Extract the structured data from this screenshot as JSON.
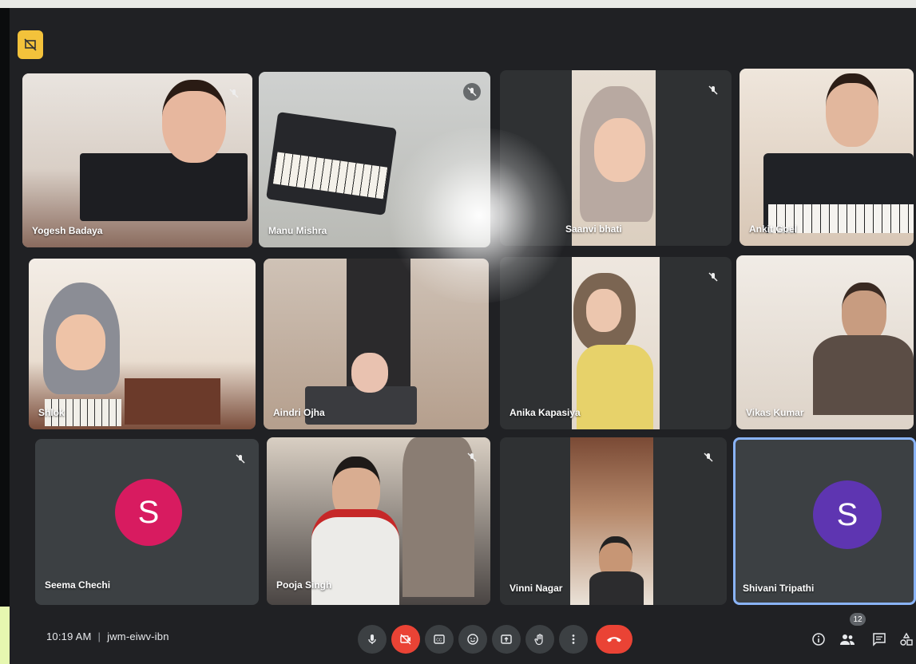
{
  "meeting": {
    "time": "10:19 AM",
    "separator": "|",
    "code": "jwm-eiwv-ibn"
  },
  "participant_count": "12",
  "participants": [
    {
      "name": "Yogesh Badaya"
    },
    {
      "name": "Manu Mishra"
    },
    {
      "name": "Saanvi bhati"
    },
    {
      "name": "Ankit Goel"
    },
    {
      "name": "Shlok"
    },
    {
      "name": "Aindri Ojha"
    },
    {
      "name": "Anika Kapasiya"
    },
    {
      "name": "Vikas Kumar"
    },
    {
      "name": "Seema Chechi",
      "initial": "S",
      "avatar_color": "#d81b60"
    },
    {
      "name": "Pooja Singh"
    },
    {
      "name": "Vinni Nagar"
    },
    {
      "name": "Shivani Tripathi",
      "initial": "S",
      "avatar_color": "#5e35b1"
    }
  ],
  "controls": [
    "microphone-icon",
    "camera-off-icon",
    "captions-icon",
    "emoji-icon",
    "present-icon",
    "raise-hand-icon",
    "more-options-icon",
    "hang-up-icon"
  ],
  "right_controls": [
    "info-icon",
    "people-icon",
    "chat-icon",
    "activities-icon"
  ]
}
